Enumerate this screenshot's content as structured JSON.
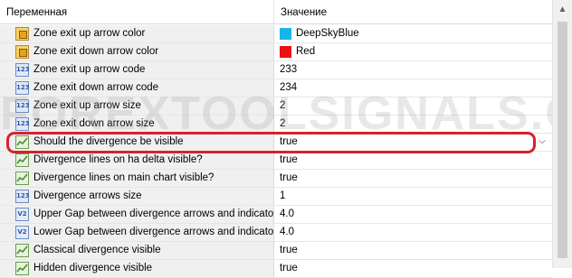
{
  "header": {
    "name_col": "Переменная",
    "value_col": "Значение"
  },
  "rows": [
    {
      "icon": "color-icon",
      "name": "Zone exit up arrow color",
      "value": "DeepSkyBlue",
      "swatch": "#1ab4ec"
    },
    {
      "icon": "color-icon",
      "name": "Zone exit down arrow color",
      "value": "Red",
      "swatch": "#ee1111"
    },
    {
      "icon": "integer-icon",
      "name": "Zone exit up arrow code",
      "value": "233"
    },
    {
      "icon": "integer-icon",
      "name": "Zone exit down arrow code",
      "value": "234"
    },
    {
      "icon": "integer-icon",
      "name": "Zone exit up arrow size",
      "value": "2"
    },
    {
      "icon": "integer-icon",
      "name": "Zone exit down arrow size",
      "value": "2"
    },
    {
      "icon": "bool-icon",
      "name": "Should the divergence be visible",
      "value": "true"
    },
    {
      "icon": "bool-icon",
      "name": "Divergence lines on ha delta visible?",
      "value": "true"
    },
    {
      "icon": "bool-icon",
      "name": "Divergence lines on main chart visible?",
      "value": "true"
    },
    {
      "icon": "integer-icon",
      "name": "Divergence arrows size",
      "value": "1"
    },
    {
      "icon": "double-icon",
      "name": "Upper Gap between divergence arrows and indicator...",
      "value": "4.0"
    },
    {
      "icon": "double-icon",
      "name": "Lower Gap between divergence arrows and indicator...",
      "value": "4.0"
    },
    {
      "icon": "bool-icon",
      "name": "Classical divergence visible",
      "value": "true"
    },
    {
      "icon": "bool-icon",
      "name": "Hidden divergence visible",
      "value": "true"
    }
  ],
  "icon_text": {
    "integer": "123",
    "double": "V2"
  },
  "dropdown_glyph": "⌵",
  "scroll_up_glyph": "▲",
  "watermark": "FOREXTOOLSIGNALS.COM",
  "highlight_color": "#d7212d"
}
